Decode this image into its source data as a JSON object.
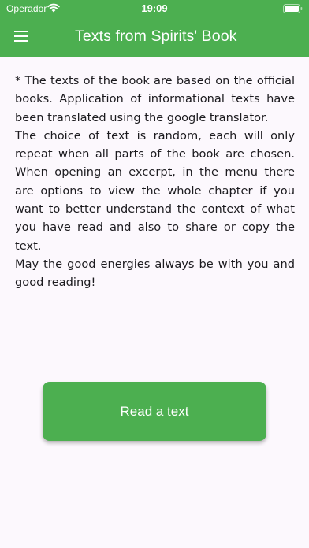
{
  "status_bar": {
    "carrier": "Operador",
    "time": "19:09",
    "wifi_icon": "wifi-icon",
    "battery_icon": "battery-icon"
  },
  "app_bar": {
    "menu_icon": "menu-icon",
    "title": "Texts from Spirits' Book",
    "color": "#4caf50"
  },
  "content": {
    "paragraphs": [
      "* The texts of the book are based on the official books. Application of informational texts have been translated using the google translator.",
      "The choice of text is random, each will only repeat when all parts of the book are chosen. When opening an excerpt, in the menu there are options to view the whole chapter if you want to better understand the context of what you have read and also to share or copy the text.",
      "May the good energies always be with you and good reading!"
    ]
  },
  "actions": {
    "read_button_label": "Read a text"
  }
}
